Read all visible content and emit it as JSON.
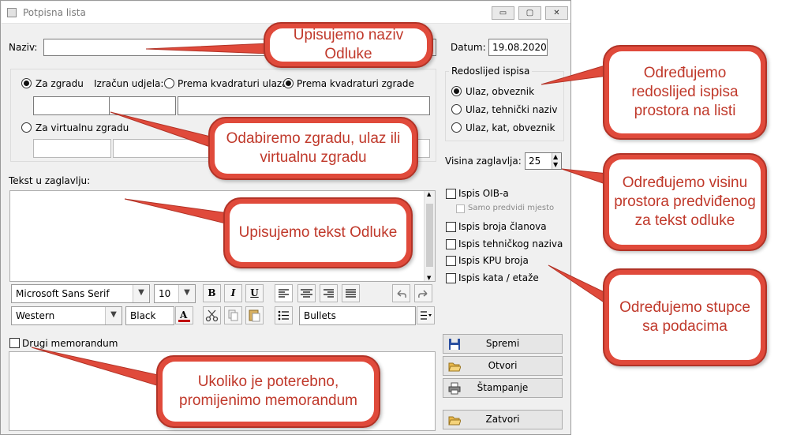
{
  "window": {
    "title": "Potpisna lista",
    "controls": {
      "minimize": "▭",
      "restore": "▢",
      "close": "✕"
    }
  },
  "form": {
    "naziv_label": "Naziv:",
    "naziv_value": "",
    "datum_label": "Datum:",
    "datum_value": "19.08.2020",
    "building": {
      "za_zgradu": "Za zgradu",
      "izracun_udjela": "Izračun udjela:",
      "prema_kvadraturi_ulaza": "Prema kvadraturi ulaza",
      "prema_kvadraturi_zgrade": "Prema kvadraturi zgrade",
      "za_virtualnu_zgradu": "Za virtualnu zgradu"
    },
    "redoslijed": {
      "legend": "Redoslijed ispisa",
      "options": [
        "Ulaz, obveznik",
        "Ulaz, tehnički naziv",
        "Ulaz, kat, obveznik"
      ]
    },
    "visina_label": "Visina zaglavlja:",
    "visina_value": "25",
    "tekst_label": "Tekst u zaglavlju:",
    "checkboxes": {
      "oib": "Ispis OIB-a",
      "samo_predvidi": "Samo predvidi mjesto",
      "broja_clanova": "Ispis broja članova",
      "tehnickog_naziva": "Ispis tehničkog naziva",
      "kpu_broja": "Ispis KPU broja",
      "kata_etaze": "Ispis kata / etaže"
    },
    "toolbar": {
      "font": "Microsoft Sans Serif",
      "size": "10",
      "bold": "B",
      "italic": "I",
      "underline": "U",
      "script": "Western",
      "color": "Black",
      "bullets": "Bullets"
    },
    "drugi_memorandum": "Drugi memorandum",
    "buttons": {
      "spremi": "Spremi",
      "otvori": "Otvori",
      "stampanje": "Štampanje",
      "zatvori": "Zatvori"
    }
  },
  "callouts": {
    "naziv": "Upisujemo naziv Odluke",
    "redoslijed": "Određujemo redoslijed ispisa prostora na listi",
    "zgrada": "Odabiremo zgradu, ulaz ili virtualnu zgradu",
    "visina": "Određujemo visinu prostora predviđenog za tekst odluke",
    "tekst": "Upisujemo tekst Odluke",
    "stupci": "Određujemo stupce sa podacima",
    "memorandum": "Ukoliko je poterebno, promijenimo memorandum"
  },
  "colors": {
    "callout_border": "#e04a3b",
    "callout_text": "#c0392b"
  }
}
